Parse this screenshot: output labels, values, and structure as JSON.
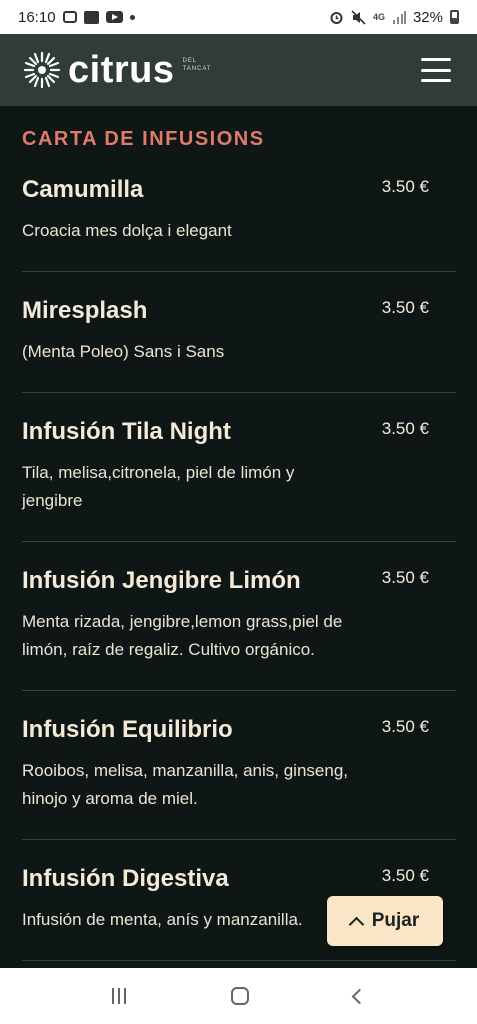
{
  "status_bar": {
    "time": "16:10",
    "network": "4G",
    "battery": "32%",
    "icons": [
      "instagram-icon",
      "gallery-icon",
      "youtube-icon",
      "dot-icon",
      "alarm-icon",
      "mute-icon",
      "signal-icon",
      "battery-icon"
    ]
  },
  "header": {
    "brand": "citrus",
    "brand_sub_1": "DEL",
    "brand_sub_2": "TANCAT",
    "menu_icon": "hamburger-icon"
  },
  "section": {
    "title": "CARTA DE INFUSIONS"
  },
  "items": [
    {
      "name": "Camumilla",
      "price": "3.50 €",
      "description": "Croacia mes dolça i elegant"
    },
    {
      "name": "Miresplash",
      "price": "3.50 €",
      "description": "(Menta Poleo) Sans i Sans"
    },
    {
      "name": "Infusión Tila Night",
      "price": "3.50 €",
      "description": "Tila, melisa,citronela, piel de limón y jengibre"
    },
    {
      "name": "Infusión Jengibre Limón",
      "price": "3.50 €",
      "description": "Menta rizada, jengibre,lemon grass,piel de limón, raíz de regaliz. Cultivo orgánico."
    },
    {
      "name": "Infusión Equilibrio",
      "price": "3.50 €",
      "description": "Rooibos, melisa, manzanilla, anis, ginseng, hinojo y aroma de miel."
    },
    {
      "name": "Infusión Digestiva",
      "price": "3.50 €",
      "description": "Infusión de menta, anís y manzanilla."
    }
  ],
  "scroll_top_button": {
    "label": "Pujar"
  },
  "colors": {
    "header_bg": "#2f3c39",
    "page_bg": "#0e1716",
    "accent": "#e07a6a",
    "text": "#f4ead8",
    "button_bg": "#fbe5c7"
  }
}
